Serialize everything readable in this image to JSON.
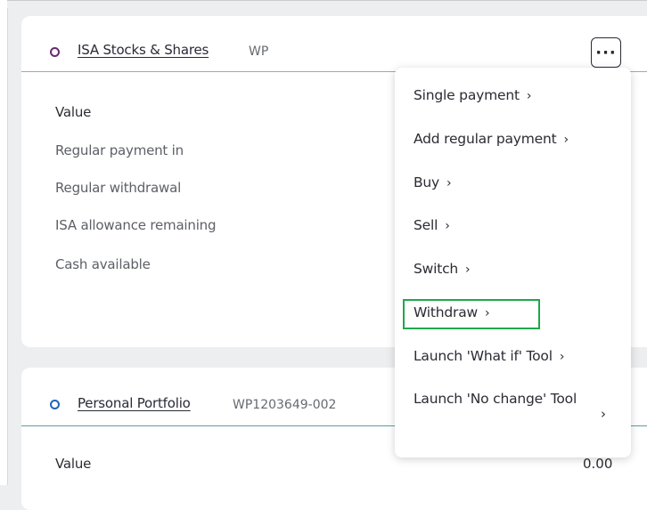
{
  "accounts": [
    {
      "name": "ISA Stocks & Shares",
      "id": "WP",
      "rows": [
        {
          "label": "Value"
        },
        {
          "label": "Regular payment in"
        },
        {
          "label": "Regular withdrawal"
        },
        {
          "label": "ISA allowance remaining"
        },
        {
          "label": "Cash available"
        }
      ],
      "more_label": "···"
    },
    {
      "name": "Personal Portfolio",
      "id": "WP1203649-002",
      "rows": [
        {
          "label": "Value",
          "value": "0.00"
        }
      ]
    }
  ],
  "menu": {
    "items": [
      {
        "label": "Single payment"
      },
      {
        "label": "Add regular payment"
      },
      {
        "label": "Buy"
      },
      {
        "label": "Sell"
      },
      {
        "label": "Switch"
      },
      {
        "label": "Withdraw",
        "highlighted": true
      },
      {
        "label": "Launch 'What if' Tool"
      },
      {
        "label": "Launch 'No change' Tool"
      }
    ],
    "chevron": "›"
  },
  "colors": {
    "highlight_border": "#1fa84a",
    "isa_accent": "#6a2a73",
    "portfolio_accent": "#1f63b5"
  }
}
